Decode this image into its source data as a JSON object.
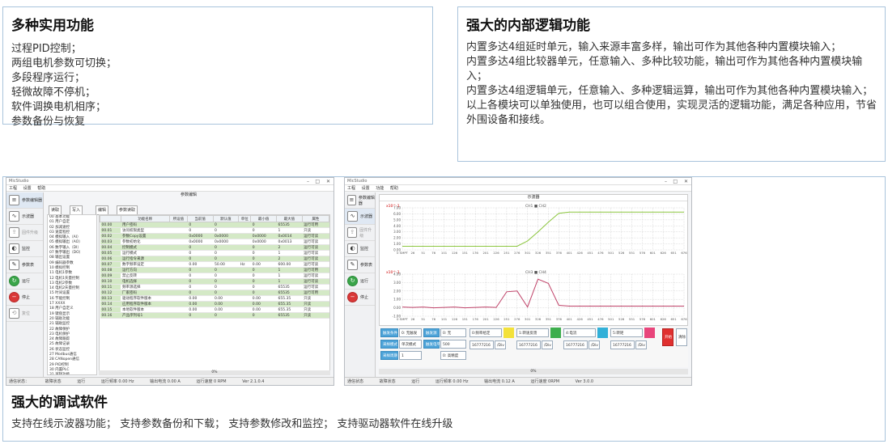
{
  "features": {
    "title": "多种实用功能",
    "items": [
      "过程PID控制；",
      "两组电机参数可切换；",
      "多段程序运行；",
      "轻微故障不停机；",
      "软件调换电机相序；",
      "参数备份与恢复"
    ]
  },
  "logic": {
    "title": "强大的内部逻辑功能",
    "paragraphs": [
      "内置多达4组延时单元，输入来源丰富多样，输出可作为其他各种内置模块输入；",
      "内置多达4组比较器单元，任意输入、多种比较功能，输出可作为其他各种内置模块输入；",
      "内置多达4组逻辑单元，任意输入、多种逻辑运算，输出可作为其他各种内置模块输入；",
      "以上各模块可以单独使用，也可以组合使用，实现灵活的逻辑功能，满足各种应用，节省外围设备和接线。"
    ]
  },
  "debug": {
    "title": "强大的调试软件",
    "description": "支持在线示波器功能；  支持参数备份和下载；  支持参数修改和监控；  支持驱动器软件在线升级"
  },
  "left_window": {
    "app_title": "MicStudio",
    "menu": [
      "工程",
      "设置",
      "帮助"
    ],
    "panel_title": "参数编辑",
    "toolbar": [
      "读取",
      "写入",
      "编辑",
      "参数读取"
    ],
    "sidebar": [
      "参数编辑器",
      "示波器",
      "固件升级",
      "监控",
      "参数表",
      "运行",
      "停止",
      "复位"
    ],
    "tree": [
      "00 基本功能",
      "01 用户自定",
      "02 加减速控",
      "03 速度程控",
      "04 模拟输入（AI）",
      "05 模拟输出（AO）",
      "06 数字输入（DI）",
      "07 数字输出（DO）",
      "08 输出设置",
      "09 编码器参数",
      "10 模拟控制",
      "11 电机1参数",
      "12 电机1矢量控制",
      "13 电机2参数",
      "14 电机2矢量控制",
      "15 时间设置",
      "16 节能控制",
      "17 XXXX",
      "18 用户自定义",
      "19 键盘显示",
      "20 辅助功能",
      "21 辅助监控",
      "22 故障保护",
      "23 电机保护",
      "24 故障跟踪",
      "25 故障记录",
      "26 状态监控",
      "27 Modbus通信",
      "28 CANopen通信",
      "29 PID控制",
      "30 内置PLC",
      "31 逻辑功能",
      "32 简易PLC",
      "33 多段程序",
      "34 延时单元"
    ],
    "columns": [
      "功能名称",
      "所设值",
      "当前值",
      "默认值",
      "单位",
      "最小值",
      "最大值",
      "属性"
    ],
    "rows": [
      [
        "00.00",
        "用户密码",
        "",
        "0",
        "0",
        "",
        "0",
        "65535",
        "运行可用"
      ],
      [
        "00.01",
        "访问权限类型",
        "",
        "0",
        "0",
        "",
        "0",
        "1",
        "只读"
      ],
      [
        "00.02",
        "参数Copy设置",
        "",
        "0x0000",
        "0x0000",
        "",
        "0x0000",
        "0x0014",
        "运行可读"
      ],
      [
        "00.03",
        "参数初始化",
        "",
        "0x0000",
        "0x0000",
        "",
        "0x0000",
        "0x0013",
        "运行可读"
      ],
      [
        "00.04",
        "控制模式",
        "",
        "0",
        "0",
        "",
        "0",
        "2",
        "运行可读"
      ],
      [
        "00.05",
        "运行模式",
        "",
        "0",
        "0",
        "",
        "0",
        "1",
        "运行可读"
      ],
      [
        "00.06",
        "运行指令来源",
        "",
        "0",
        "0",
        "",
        "0",
        "2",
        "运行可读"
      ],
      [
        "00.07",
        "数字频率设定",
        "",
        "0.00",
        "50.00",
        "Hz",
        "0.00",
        "600.00",
        "运行可读"
      ],
      [
        "00.08",
        "运行方向",
        "",
        "0",
        "0",
        "",
        "0",
        "1",
        "运行可用"
      ],
      [
        "00.09",
        "禁止反转",
        "",
        "0",
        "0",
        "",
        "0",
        "1",
        "运行可读"
      ],
      [
        "00.10",
        "电机选择",
        "",
        "0",
        "0",
        "",
        "0",
        "1",
        "运行可读"
      ],
      [
        "00.11",
        "频率源选择",
        "",
        "0",
        "0",
        "",
        "0",
        "65535",
        "运行可读"
      ],
      [
        "00.12",
        "厂家密码",
        "",
        "0",
        "0",
        "",
        "0",
        "65535",
        "运行可用"
      ],
      [
        "00.13",
        "驱动程序软件版本",
        "",
        "0.00",
        "0.00",
        "",
        "0.00",
        "655.35",
        "只读"
      ],
      [
        "00.14",
        "应用程序软件版本",
        "",
        "0.00",
        "0.00",
        "",
        "0.00",
        "655.35",
        "只读"
      ],
      [
        "00.15",
        "本地软件版本",
        "",
        "0.00",
        "0.00",
        "",
        "0.00",
        "655.35",
        "只读"
      ],
      [
        "00.16",
        "产品序列号1",
        "",
        "0",
        "0",
        "",
        "0",
        "65535",
        "只读"
      ]
    ],
    "progress": "0%",
    "status": [
      "通信状态：",
      "故障状态",
      "运行",
      "运行频率 0.00 Hz",
      "输出电流 0.00 A",
      "运行速度 0 RPM",
      "Ver 2.1.0.4"
    ]
  },
  "right_window": {
    "app_title": "MicStudio",
    "menu": [
      "工程",
      "设置",
      "功能",
      "帮助"
    ],
    "panel_title": "示波器",
    "sidebar": [
      "参数编辑器",
      "示波器",
      "固件升级",
      "监控",
      "参数表",
      "运行",
      "停止"
    ],
    "plot1_legend": "CH1 ■ CH2",
    "plot1_scale": "x10^-1",
    "plot1_yticks": [
      "7.00",
      "6.00",
      "5.00",
      "4.00",
      "3.00",
      "2.00",
      "1.00",
      "0.00"
    ],
    "plot2_legend": "CH3 ■ CH4",
    "plot2_scale": "x10^-1",
    "plot2_yticks": [
      "4.00",
      "3.00",
      "2.00",
      "1.00",
      "0.00",
      "-1.00"
    ],
    "xticks": [
      "0 SMPT",
      "26",
      "51",
      "76",
      "101",
      "126",
      "151",
      "176",
      "201",
      "226",
      "251",
      "276",
      "301",
      "326",
      "351",
      "376",
      "401",
      "426",
      "451",
      "476",
      "501",
      "526",
      "551",
      "576",
      "601",
      "626",
      "651",
      "676"
    ],
    "chart_data": [
      {
        "type": "line",
        "series": [
          {
            "name": "CH1",
            "color": "#8cc63f",
            "values": [
              0.6,
              0.6,
              0.6,
              0.6,
              0.6,
              0.6,
              0.6,
              0.6,
              0.6,
              0.6,
              0.6,
              0.6,
              1.5,
              3.0,
              4.6,
              6.1,
              6.3,
              6.3,
              6.3,
              6.3,
              6.3,
              6.3,
              6.3,
              6.3,
              6.3,
              6.3,
              6.3,
              6.3
            ]
          }
        ],
        "ylim": [
          0,
          7
        ]
      },
      {
        "type": "line",
        "series": [
          {
            "name": "CH3",
            "color": "#c0446a",
            "values": [
              0.1,
              0.05,
              0.1,
              0.0,
              0.05,
              0.1,
              0.0,
              0.05,
              0.1,
              0.05,
              1.9,
              2.0,
              0.1,
              3.4,
              2.9,
              0.3,
              0.2,
              0.2,
              0.2,
              0.2,
              0.2,
              0.2,
              0.2,
              0.2,
              0.2,
              0.2,
              0.2,
              0.2
            ]
          }
        ],
        "ylim": [
          -1,
          4
        ]
      }
    ],
    "controls": {
      "trigger_label": "触发条件",
      "trigger_val": "0: 无触发",
      "mode_label": "采样模式",
      "mode_val": "单次模式",
      "interval_label": "采样周期",
      "interval_val": "1",
      "source_label": "触发源",
      "source_val": "0: 无",
      "level_label": "触发电平",
      "level_val": "500",
      "fmt_label": "0: 高精度",
      "ch1": "0:频率给定",
      "ch2": "1:转速反馈",
      "ch3": "4:电流",
      "ch4": "5:转矩",
      "ch_vals": [
        "16777216",
        "16777216",
        "16777216",
        "16777216"
      ],
      "ch_scales": [
        "/Div",
        "/Div",
        "/Div",
        "/Div"
      ],
      "btn_start": "开始",
      "btn_stop": "清除"
    },
    "swatch_colors": [
      "#f3e13a",
      "#3dae4d",
      "#32b0d8",
      "#e8457b"
    ],
    "progress": "0%",
    "status": [
      "通信状态",
      "故障状态",
      "运行",
      "运行频率 0.00 Hz",
      "输出电流 0.12 A",
      "运行速度 0RPM",
      "Ver 3.0.0"
    ]
  }
}
